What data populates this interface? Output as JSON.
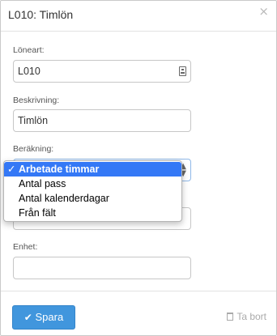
{
  "dialog": {
    "title": "L010: Timlön",
    "close_symbol": "×"
  },
  "form": {
    "loneart": {
      "label": "Löneart:",
      "value": "L010",
      "icon": "contact-card-icon"
    },
    "beskrivning": {
      "label": "Beskrivning:",
      "value": "Timlön"
    },
    "berakning": {
      "label": "Beräkning:",
      "selected": "Arbetade timmar",
      "options": [
        {
          "label": "Arbetade timmar",
          "selected": true,
          "check": "✓"
        },
        {
          "label": "Antal pass",
          "selected": false
        },
        {
          "label": "Antal kalenderdagar",
          "selected": false
        },
        {
          "label": "Från fält",
          "selected": false
        }
      ]
    },
    "enhet": {
      "label": "Enhet:",
      "value": ""
    }
  },
  "footer": {
    "save_label": "Spara",
    "save_icon": "check-icon",
    "delete_label": "Ta bort",
    "delete_icon": "trash-icon"
  },
  "colors": {
    "primary_button": "#4196dd",
    "selected_option": "#3478f6"
  }
}
